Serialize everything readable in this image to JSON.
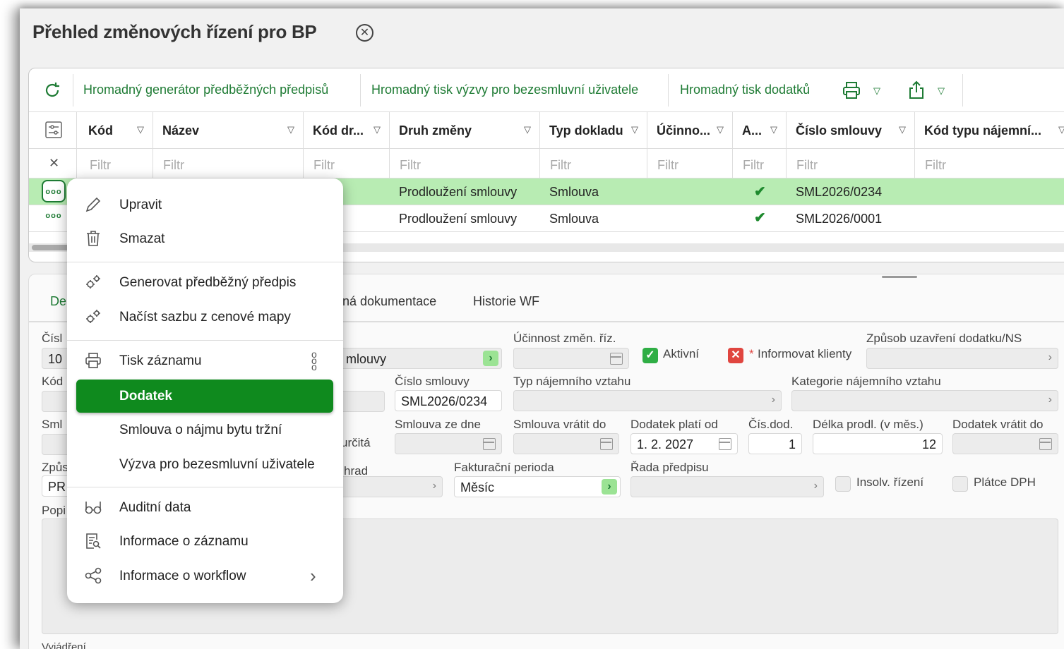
{
  "title": "Přehled změnových řízení pro BP",
  "toolbar": {
    "btn1": "Hromadný generátor předběžných předpisů",
    "btn2": "Hromadný tisk výzvy pro bezesmluvní uživatele",
    "btn3": "Hromadný tisk dodatků"
  },
  "columns": [
    "Kód",
    "Název",
    "Kód dr...",
    "Druh změny",
    "Typ dokladu",
    "Účinno...",
    "A...",
    "Číslo smlouvy",
    "Kód typu nájemní..."
  ],
  "filter_placeholder": "Filtr",
  "rows": [
    {
      "druh": "Prodloužení smlouvy",
      "typ": "Smlouva",
      "cislo": "SML2026/0234",
      "selected": true
    },
    {
      "druh": "Prodloužení smlouvy",
      "typ": "Smlouva",
      "cislo": "SML2026/0001",
      "selected": false
    }
  ],
  "tabs": {
    "t1": "De",
    "t2": "ná dokumentace",
    "t3": "Historie WF"
  },
  "form": {
    "cisl_label": "Čísl",
    "cisl_val": "10",
    "kod_label": "Kód",
    "sml_label": "Sml",
    "zpus_label": "Způs",
    "zpus_val": "PR",
    "popi_label": "Popi",
    "vyj_label": "Vyjádření",
    "druh_val": "mlouvy",
    "ucinnost_label": "Účinnost změn. říz.",
    "aktivni_label": "Aktivní",
    "informovat_label": "Informovat klienty",
    "zpusob_label": "Způsob uzavření dodatku/NS",
    "cislo_smlouvy_label": "Číslo smlouvy",
    "cislo_smlouvy_val": "SML2026/0234",
    "typ_label": "Typ nájemního vztahu",
    "kategorie_label": "Kategorie nájemního vztahu",
    "urcita": "určitá",
    "sml_ze_dne_label": "Smlouva ze dne",
    "sml_vratit_label": "Smlouva vrátit do",
    "dod_plati_label": "Dodatek platí od",
    "dod_plati_val": "1. 2. 2027",
    "cis_dod_label": "Čís.dod.",
    "cis_dod_val": "1",
    "delka_label": "Délka prodl. (v měs.)",
    "delka_val": "12",
    "dod_vratit_label": "Dodatek vrátit do",
    "hrad": "hrad",
    "fakt_label": "Fakturační perioda",
    "fakt_val": "Měsíc",
    "rada_label": "Řada předpisu",
    "insolv_label": "Insolv. řízení",
    "platce_label": "Plátce DPH"
  },
  "menu": {
    "upravit": "Upravit",
    "smazat": "Smazat",
    "generovat": "Generovat předběžný předpis",
    "nacist": "Načíst sazbu z cenové mapy",
    "tisk": "Tisk záznamu",
    "dodatek": "Dodatek",
    "smlouva_najem": "Smlouva o nájmu bytu tržní",
    "vyzva": "Výzva pro bezesmluvní uživatele",
    "auditni": "Auditní data",
    "info_zaznam": "Informace o záznamu",
    "info_wf": "Informace o workflow"
  },
  "colors": {
    "accent": "#1e7b34",
    "selected_row": "#b8ecb3",
    "menu_highlight": "#0f8a1e",
    "check_red": "#e0453f"
  }
}
